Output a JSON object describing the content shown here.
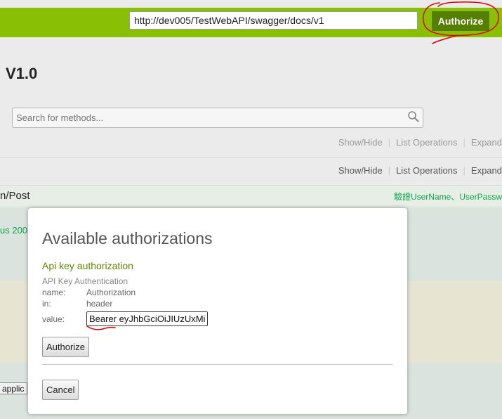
{
  "header": {
    "url_value": "http://dev005/TestWebAPI/swagger/docs/v1",
    "authorize_label": "Authorize"
  },
  "api": {
    "title": "V1.0",
    "search_placeholder": "Search for methods..."
  },
  "operations_bar": {
    "show_hide": "Show/Hide",
    "list_operations": "List Operations",
    "expand": "Expand"
  },
  "endpoint": {
    "path": "n/Post",
    "description": "驗證UserName、UserPassw",
    "status_text": "us 200",
    "content_type_button": "applic"
  },
  "modal": {
    "title": "Available authorizations",
    "auth_heading": "Api key authorization",
    "auth_type": "API Key Authentication",
    "name_label": "name:",
    "name_value": "Authorization",
    "in_label": "in:",
    "in_value": "header",
    "value_label": "value:",
    "value_input": "Bearer eyJhbGciOiJIUzUxMi",
    "authorize_button": "Authorize",
    "cancel_button": "Cancel"
  },
  "colors": {
    "header_bg": "#89bf04",
    "authorize_btn_bg": "#547f00",
    "annotation_red": "#e00000",
    "desc_green": "#10a54a"
  },
  "icons": {
    "search": "search-icon"
  }
}
